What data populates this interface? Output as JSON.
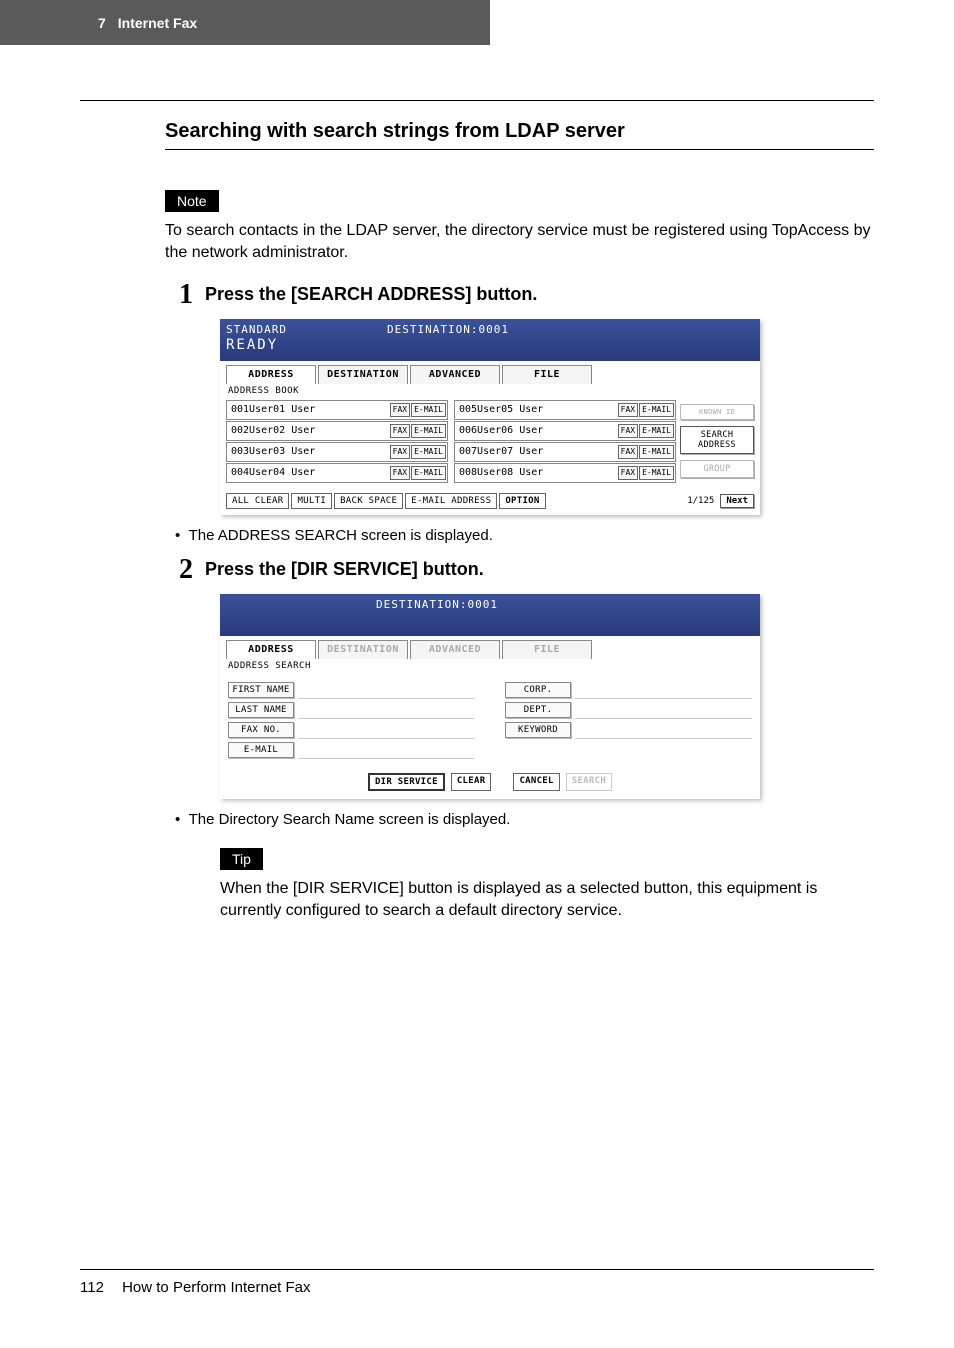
{
  "header": {
    "chapter": "7",
    "title": "Internet Fax"
  },
  "section_title": "Searching with search strings from LDAP server",
  "note": {
    "label": "Note",
    "text": "To search contacts in the LDAP server, the directory service must be registered using TopAccess by the network administrator."
  },
  "step1": {
    "num": "1",
    "title": "Press the [SEARCH ADDRESS] button.",
    "bullet": "The ADDRESS SEARCH screen is displayed."
  },
  "panel1": {
    "mode": "STANDARD",
    "destination": "DESTINATION:0001",
    "ready": "READY",
    "tabs": {
      "address": "ADDRESS",
      "destination": "DESTINATION",
      "advanced": "ADVANCED",
      "file": "FILE"
    },
    "subtitle": "ADDRESS BOOK",
    "rows_left": [
      {
        "name": "001User01 User"
      },
      {
        "name": "002User02 User"
      },
      {
        "name": "003User03 User"
      },
      {
        "name": "004User04 User"
      }
    ],
    "rows_right": [
      {
        "name": "005User05 User"
      },
      {
        "name": "006User06 User"
      },
      {
        "name": "007User07 User"
      },
      {
        "name": "008User08 User"
      }
    ],
    "row_btn_fax": "FAX",
    "row_btn_email": "E-MAIL",
    "side": {
      "known_id": "KNOWN ID",
      "search_address": "SEARCH ADDRESS",
      "group": "GROUP"
    },
    "bottom": {
      "all_clear": "ALL CLEAR",
      "multi": "MULTI",
      "back_space": "BACK SPACE",
      "email_address": "E-MAIL ADDRESS",
      "option": "OPTION",
      "page": "1/125",
      "next": "Next"
    }
  },
  "step2": {
    "num": "2",
    "title": "Press the [DIR SERVICE] button.",
    "bullet": "The Directory Search Name screen is displayed."
  },
  "panel2": {
    "destination": "DESTINATION:0001",
    "tabs": {
      "address": "ADDRESS",
      "destination": "DESTINATION",
      "advanced": "ADVANCED",
      "file": "FILE"
    },
    "subtitle": "ADDRESS SEARCH",
    "fields_left": {
      "first_name": "FIRST NAME",
      "last_name": "LAST NAME",
      "fax_no": "FAX NO.",
      "email": "E-MAIL"
    },
    "fields_right": {
      "corp": "CORP.",
      "dept": "DEPT.",
      "keyword": "KEYWORD"
    },
    "bottom": {
      "dir_service": "DIR SERVICE",
      "clear": "CLEAR",
      "cancel": "CANCEL",
      "search": "SEARCH"
    }
  },
  "tip": {
    "label": "Tip",
    "text": "When the [DIR SERVICE] button is displayed as a selected button, this equipment is currently configured to search a default directory service."
  },
  "footer": {
    "page_num": "112",
    "title": "How to Perform Internet Fax"
  }
}
